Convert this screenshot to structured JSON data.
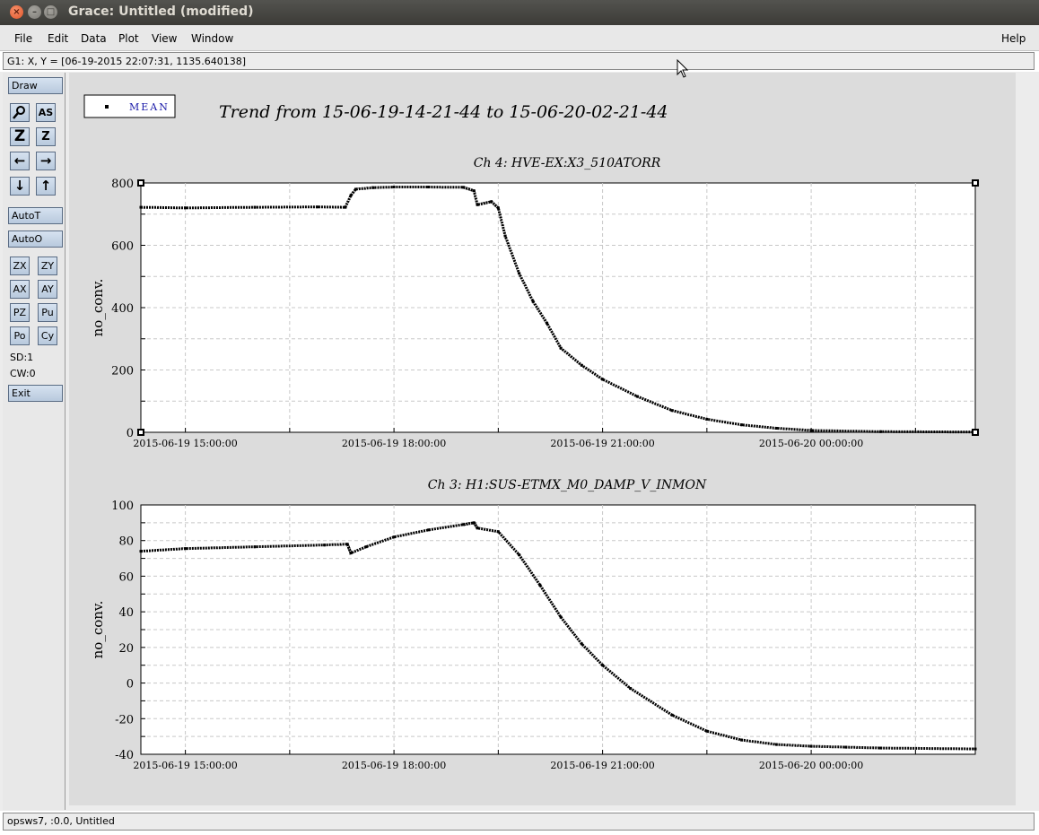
{
  "window": {
    "title": "Grace: Untitled (modified)"
  },
  "menu": {
    "items": [
      "File",
      "Edit",
      "Data",
      "Plot",
      "View",
      "Window"
    ],
    "help": "Help"
  },
  "locator": {
    "text": "G1: X, Y = [06-19-2015 22:07:31, 1135.640138]"
  },
  "toolbar": {
    "draw": "Draw",
    "autot": "AutoT",
    "autoo": "AutoO",
    "zx": "ZX",
    "zy": "ZY",
    "ax": "AX",
    "ay": "AY",
    "pz": "PZ",
    "pu": "Pu",
    "po": "Po",
    "cy": "Cy",
    "sd": "SD:1",
    "cw": "CW:0",
    "exit": "Exit",
    "zoom_icon": "Z",
    "zoom_alt_icon": "Z",
    "text_icon": "AS"
  },
  "status": {
    "text": "opsws7, :0.0, Untitled"
  },
  "legend": {
    "label": "MEAN"
  },
  "plot_title": "Trend from 15-06-19-14-21-44 to 15-06-20-02-21-44",
  "colors": {
    "trace": "#000000",
    "plot_bg": "#ffffff",
    "canvas_bg": "#dcdcdc",
    "legend_text": "#1a1aa8"
  },
  "chart_data": [
    {
      "type": "scatter",
      "title": "Ch 4: HVE-EX:X3_510ATORR",
      "xlabel": "",
      "ylabel": "no_conv.",
      "xlim": [
        14.36,
        26.36
      ],
      "ylim": [
        0,
        800
      ],
      "yticks": [
        0,
        200,
        400,
        600,
        800
      ],
      "xticks": [
        {
          "x": 15,
          "label": "2015-06-19 15:00:00"
        },
        {
          "x": 18,
          "label": "2015-06-19 18:00:00"
        },
        {
          "x": 21,
          "label": "2015-06-19 21:00:00"
        },
        {
          "x": 24,
          "label": "2015-06-20 00:00:00"
        }
      ],
      "x": [
        14.36,
        15.0,
        16.0,
        16.9,
        17.3,
        17.38,
        17.45,
        17.7,
        18.0,
        18.5,
        19.0,
        19.15,
        19.2,
        19.4,
        19.5,
        19.6,
        19.8,
        20.0,
        20.2,
        20.4,
        20.7,
        21.0,
        21.5,
        22.0,
        22.5,
        23.0,
        23.5,
        24.0,
        25.0,
        26.36
      ],
      "y": [
        722,
        720,
        722,
        723,
        722,
        760,
        780,
        785,
        787,
        787,
        786,
        775,
        730,
        740,
        720,
        630,
        510,
        420,
        350,
        270,
        215,
        170,
        115,
        70,
        42,
        24,
        13,
        6,
        2,
        1
      ]
    },
    {
      "type": "scatter",
      "title": "Ch 3: H1:SUS-ETMX_M0_DAMP_V_INMON",
      "xlabel": "",
      "ylabel": "no_conv.",
      "xlim": [
        14.36,
        26.36
      ],
      "ylim": [
        -40,
        100
      ],
      "yticks": [
        -40,
        -20,
        0,
        20,
        40,
        60,
        80,
        100
      ],
      "xticks": [
        {
          "x": 15,
          "label": "2015-06-19 15:00:00"
        },
        {
          "x": 18,
          "label": "2015-06-19 18:00:00"
        },
        {
          "x": 21,
          "label": "2015-06-19 21:00:00"
        },
        {
          "x": 24,
          "label": "2015-06-20 00:00:00"
        }
      ],
      "x": [
        14.36,
        15.0,
        16.0,
        17.0,
        17.33,
        17.38,
        17.6,
        18.0,
        18.5,
        19.0,
        19.15,
        19.2,
        19.5,
        19.8,
        20.1,
        20.4,
        20.7,
        21.0,
        21.4,
        22.0,
        22.5,
        23.0,
        23.5,
        24.0,
        24.5,
        25.0,
        26.36
      ],
      "y": [
        74,
        75.5,
        76.5,
        77.5,
        78,
        73,
        76.5,
        82,
        86,
        89,
        90,
        87,
        85,
        72,
        55,
        37,
        22,
        10,
        -3,
        -18,
        -27,
        -32,
        -34.5,
        -35.5,
        -36,
        -36.5,
        -37
      ]
    }
  ]
}
